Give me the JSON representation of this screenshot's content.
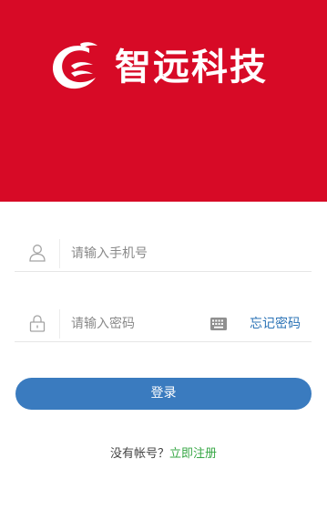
{
  "brand": {
    "name": "智远科技",
    "background_color": "#d70a26",
    "logo_icon": "brand-logo-icon"
  },
  "login_form": {
    "phone": {
      "icon": "user-icon",
      "placeholder": "请输入手机号",
      "value": ""
    },
    "password": {
      "icon": "lock-icon",
      "placeholder": "请输入密码",
      "value": "",
      "keyboard_icon": "keyboard-icon",
      "forgot_label": "忘记密码"
    },
    "submit_label": "登录",
    "submit_color": "#3a7bbf"
  },
  "signup": {
    "prompt": "没有帐号？",
    "link_label": "立即注册",
    "link_color": "#37a745"
  }
}
